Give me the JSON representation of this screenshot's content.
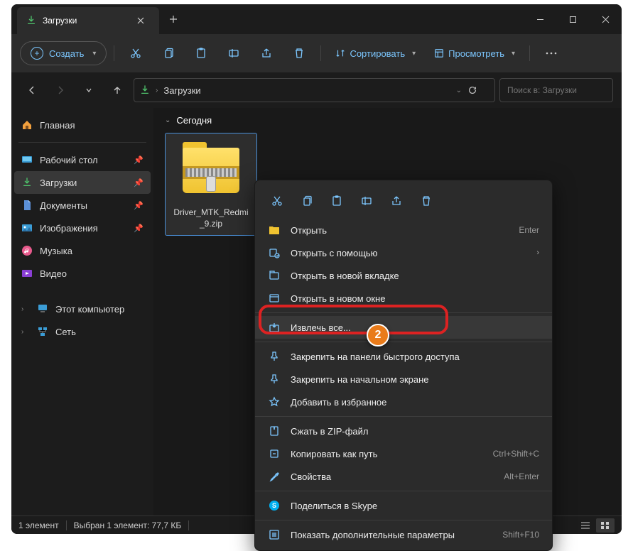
{
  "window": {
    "tab_title": "Загрузки"
  },
  "toolbar": {
    "create": "Создать",
    "sort": "Сортировать",
    "view": "Просмотреть"
  },
  "breadcrumb": {
    "current": "Загрузки"
  },
  "search": {
    "placeholder": "Поиск в: Загрузки"
  },
  "sidebar": {
    "home": "Главная",
    "quick": [
      {
        "label": "Рабочий стол"
      },
      {
        "label": "Загрузки"
      },
      {
        "label": "Документы"
      },
      {
        "label": "Изображения"
      },
      {
        "label": "Музыка"
      },
      {
        "label": "Видео"
      }
    ],
    "this_pc": "Этот компьютер",
    "network": "Сеть"
  },
  "content": {
    "group_today": "Сегодня",
    "file_name": "Driver_MTK_Redmi_9.zip"
  },
  "context_menu": {
    "items": [
      {
        "label": "Открыть",
        "shortcut": "Enter"
      },
      {
        "label": "Открыть с помощью",
        "arrow": true
      },
      {
        "label": "Открыть в новой вкладке"
      },
      {
        "label": "Открыть в новом окне"
      },
      {
        "label": "Извлечь все..."
      },
      {
        "label": "Закрепить на панели быстрого доступа"
      },
      {
        "label": "Закрепить на начальном экране"
      },
      {
        "label": "Добавить в избранное"
      },
      {
        "label": "Сжать в ZIP-файл"
      },
      {
        "label": "Копировать как путь",
        "shortcut": "Ctrl+Shift+C"
      },
      {
        "label": "Свойства",
        "shortcut": "Alt+Enter"
      },
      {
        "label": "Поделиться в Skype"
      },
      {
        "label": "Показать дополнительные параметры",
        "shortcut": "Shift+F10"
      }
    ]
  },
  "status": {
    "count": "1 элемент",
    "selection": "Выбран 1 элемент: 77,7 КБ"
  },
  "annotation": {
    "badge": "2"
  }
}
